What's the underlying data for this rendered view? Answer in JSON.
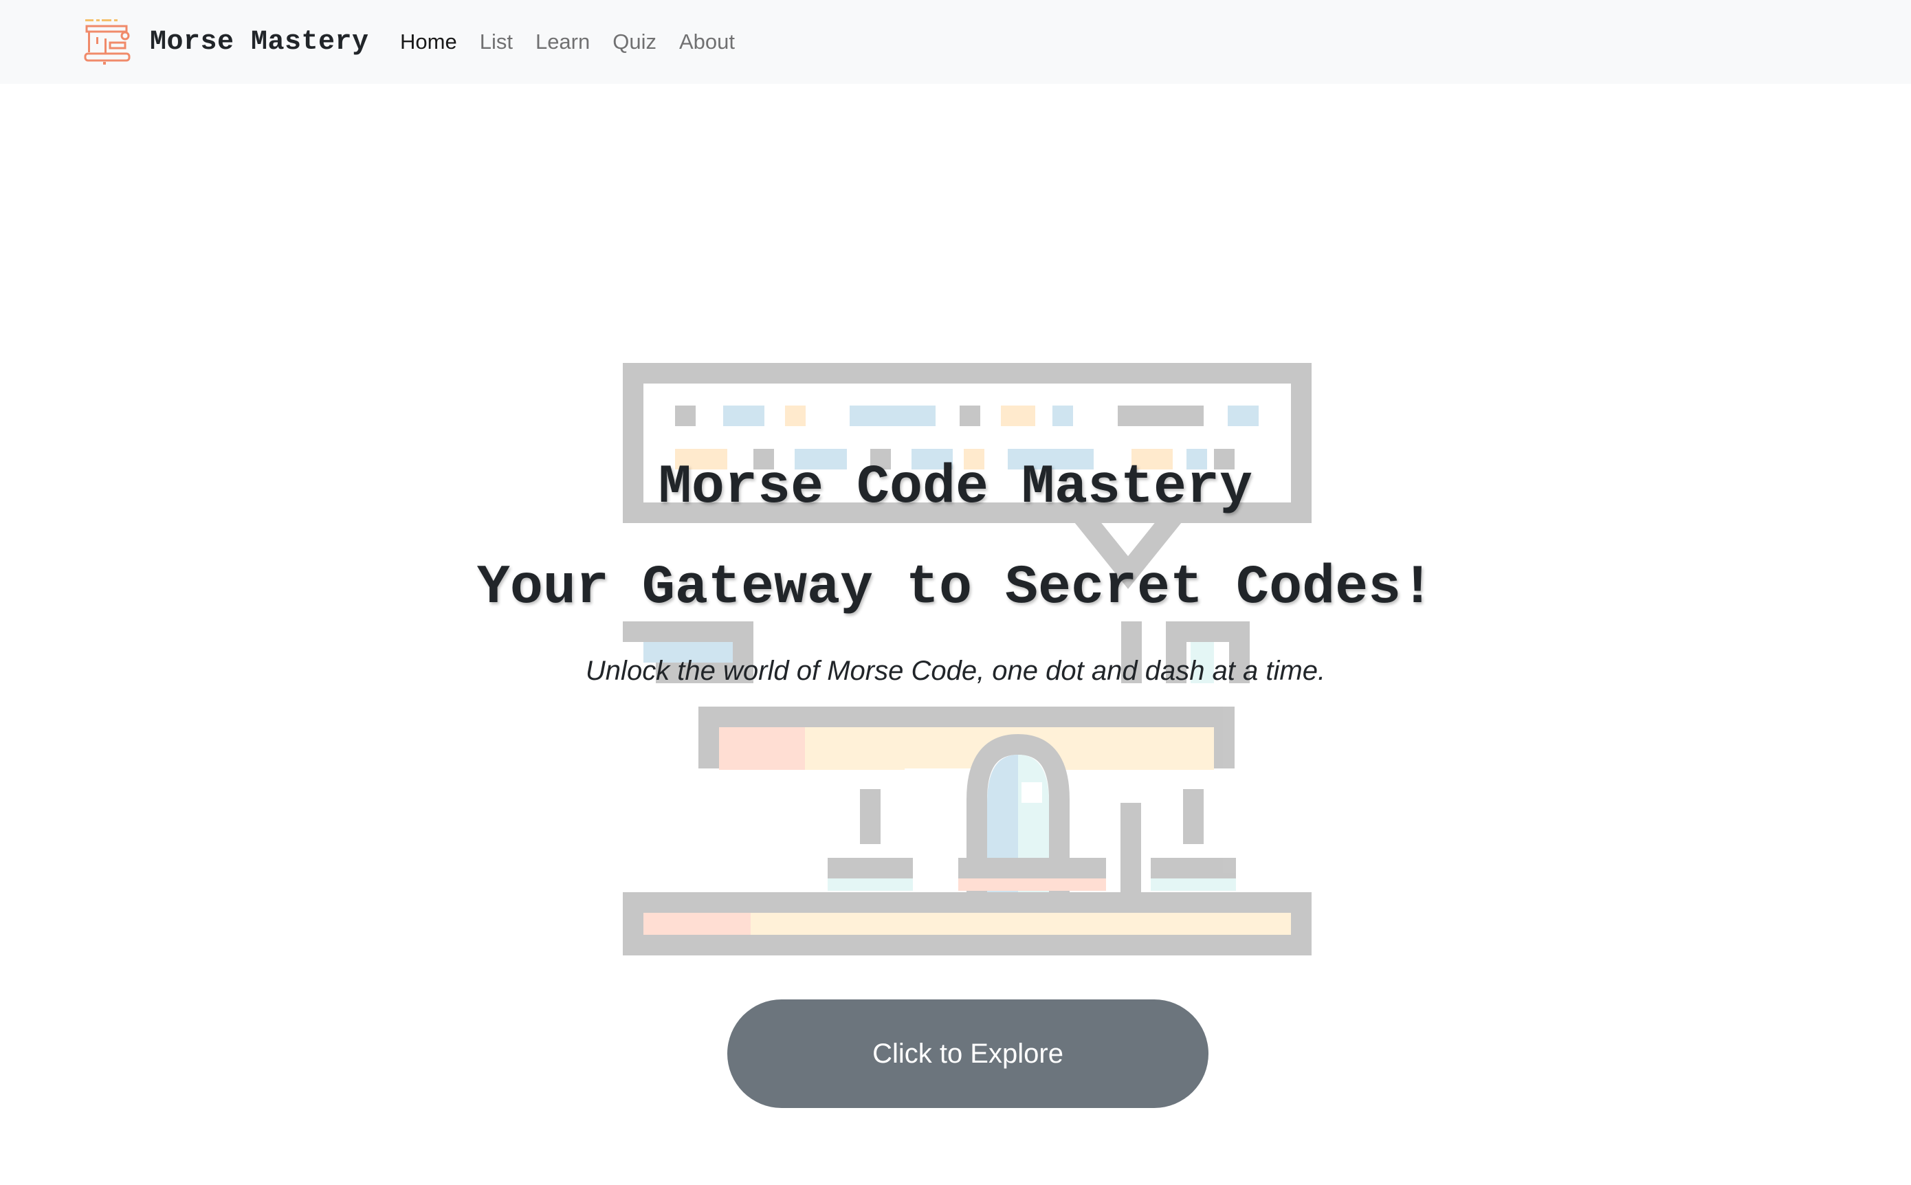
{
  "navbar": {
    "brand": "Morse Mastery",
    "logo_icon": "telegraph-key-icon",
    "links": [
      {
        "label": "Home",
        "active": true
      },
      {
        "label": "List",
        "active": false
      },
      {
        "label": "Learn",
        "active": false
      },
      {
        "label": "Quiz",
        "active": false
      },
      {
        "label": "About",
        "active": false
      }
    ]
  },
  "hero": {
    "title": "Morse Code Mastery",
    "subtitle": "Your Gateway to Secret Codes!",
    "tagline": "Unlock the world of Morse Code, one dot and dash at a time.",
    "button_label": "Click to Explore",
    "illustration_icon": "telegraph-machine-icon"
  },
  "colors": {
    "navbar_bg": "#f8f9fa",
    "button_bg": "#6c757d",
    "logo_accent": "#f08a6a",
    "logo_secondary": "#f5c06a"
  }
}
